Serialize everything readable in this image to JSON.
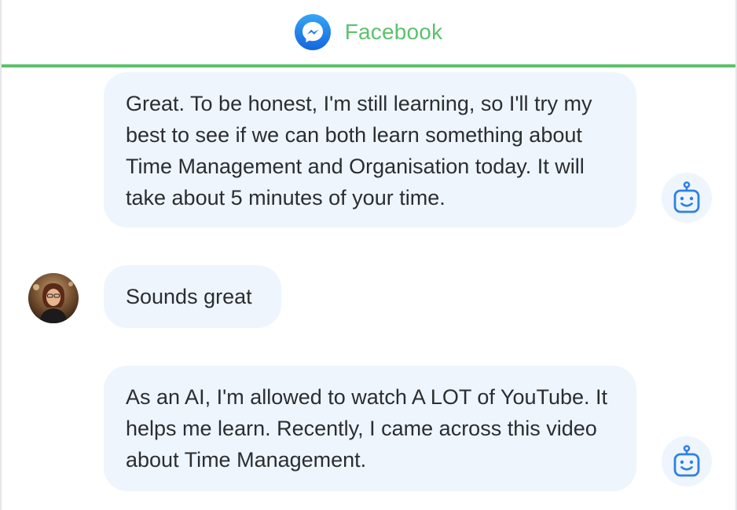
{
  "header": {
    "app_name": "Facebook",
    "app_icon": "messenger-icon",
    "accent_color": "#5cc26e",
    "icon_color": "#1e7fe8"
  },
  "messages": [
    {
      "sender": "bot",
      "avatar_icon": "robot-icon",
      "text": "Great. To be honest, I'm still learning, so I'll try my best to see if we can both learn something about Time Management and Organisation today. It will take about 5 minutes of your time."
    },
    {
      "sender": "user",
      "avatar_icon": "user-photo",
      "text": "Sounds great"
    },
    {
      "sender": "bot",
      "avatar_icon": "robot-icon",
      "text": "As an AI, I'm allowed to watch A LOT of YouTube. It helps me learn. Recently, I came across this video about Time Management."
    }
  ],
  "colors": {
    "bubble_bg": "#eef5fd",
    "text": "#2b2d31",
    "bot_icon": "#2f80e0"
  }
}
